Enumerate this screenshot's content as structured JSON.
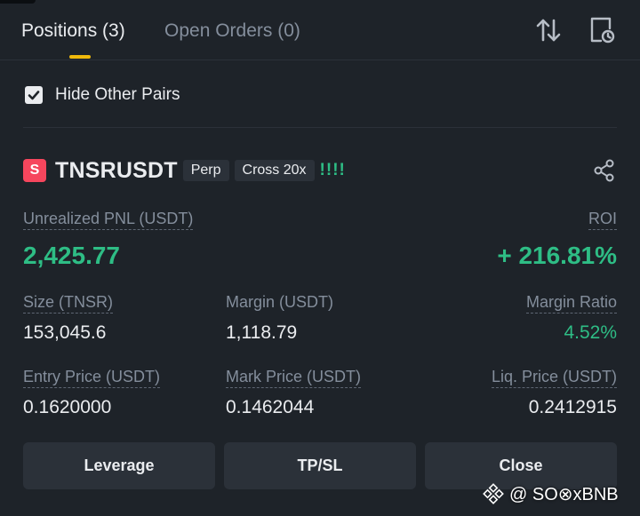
{
  "tabs": [
    {
      "label": "Positions (3)",
      "active": true
    },
    {
      "label": "Open Orders (0)",
      "active": false
    }
  ],
  "toolbar": {
    "sort_icon": "sort-arrows-icon",
    "history_icon": "order-history-icon"
  },
  "filter": {
    "hide_other_pairs_label": "Hide Other Pairs",
    "hide_other_pairs_checked": true
  },
  "position": {
    "side_badge": "S",
    "symbol": "TNSRUSDT",
    "type_tag": "Perp",
    "margin_tag": "Cross 20x",
    "signal": "!!!!",
    "share_icon": "share-icon",
    "unrealized_pnl_label": "Unrealized PNL (USDT)",
    "unrealized_pnl_value": "2,425.77",
    "roi_label": "ROI",
    "roi_value": "+ 216.81%",
    "size_label": "Size (TNSR)",
    "size_value": "153,045.6",
    "margin_label": "Margin (USDT)",
    "margin_value": "1,118.79",
    "margin_ratio_label": "Margin Ratio",
    "margin_ratio_value": "4.52%",
    "entry_price_label": "Entry Price (USDT)",
    "entry_price_value": "0.1620000",
    "mark_price_label": "Mark Price (USDT)",
    "mark_price_value": "0.1462044",
    "liq_price_label": "Liq. Price (USDT)",
    "liq_price_value": "0.2412915"
  },
  "actions": {
    "leverage": "Leverage",
    "tpsl": "TP/SL",
    "close": "Close"
  },
  "watermark": {
    "text": "@ SO⊗xBNB"
  },
  "colors": {
    "background": "#1E2329",
    "surface": "#2B3139",
    "accent": "#F0B90B",
    "positive": "#2EBD85",
    "short": "#F6465D",
    "muted_text": "#848E9C"
  }
}
